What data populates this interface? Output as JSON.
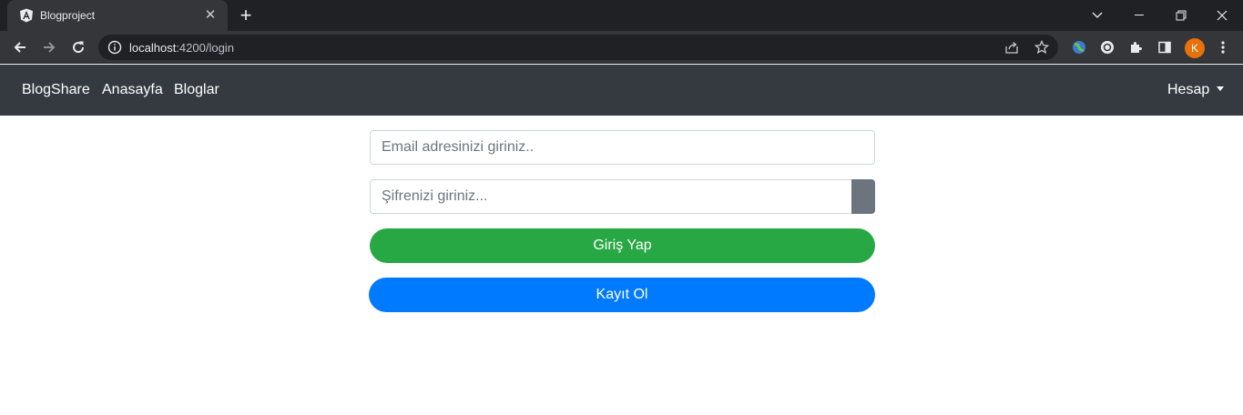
{
  "browser": {
    "tab_title": "Blogproject",
    "url_host": "localhost",
    "url_path": ":4200/login",
    "profile_initial": "K"
  },
  "navbar": {
    "brand": "BlogShare",
    "links": [
      "Anasayfa",
      "Bloglar"
    ],
    "account_label": "Hesap"
  },
  "login_form": {
    "email_placeholder": "Email adresinizi giriniz..",
    "password_placeholder": "Şifrenizi giriniz...",
    "login_label": "Giriş Yap",
    "register_label": "Kayıt Ol"
  },
  "colors": {
    "navbar": "#343a40",
    "login_button": "#28a745",
    "register_button": "#007bff",
    "password_toggle": "#6c757d"
  }
}
